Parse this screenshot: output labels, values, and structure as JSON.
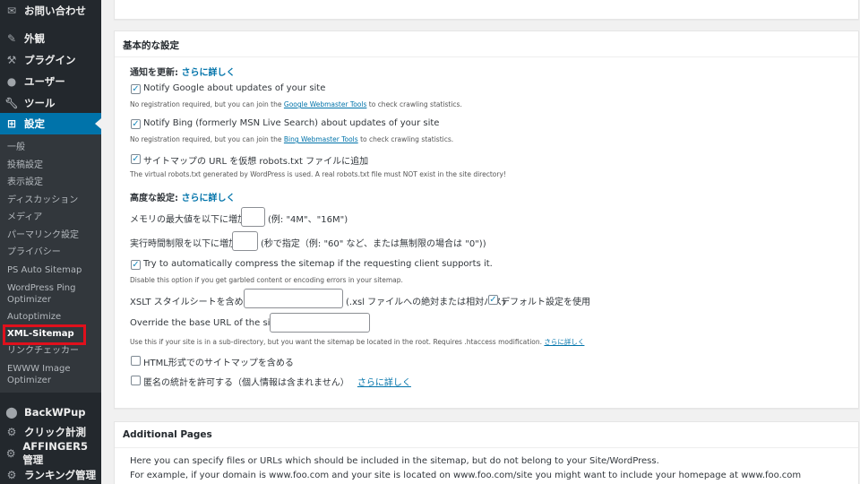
{
  "sidebar": {
    "top_items": [
      {
        "label": "お問い合わせ",
        "icon": "mail-icon"
      },
      {
        "label": "外観",
        "icon": "paintbrush-icon"
      },
      {
        "label": "プラグイン",
        "icon": "plugin-icon"
      },
      {
        "label": "ユーザー",
        "icon": "user-icon"
      },
      {
        "label": "ツール",
        "icon": "wrench-icon"
      },
      {
        "label": "設定",
        "icon": "settings-icon"
      }
    ],
    "submenu": [
      "一般",
      "投稿設定",
      "表示設定",
      "ディスカッション",
      "メディア",
      "パーマリンク設定",
      "プライバシー",
      "PS Auto Sitemap",
      "WordPress Ping Optimizer",
      "Autoptimize",
      "XML-Sitemap",
      "リンクチェッカー",
      "EWWW Image Optimizer"
    ],
    "bottom_items": [
      {
        "label": "BackWPup",
        "icon": "backwpup-icon"
      },
      {
        "label": "クリック計測",
        "icon": "gear-icon"
      },
      {
        "label": "AFFINGER5 管理",
        "icon": "gear-icon"
      },
      {
        "label": "ランキング管理",
        "icon": "gear-icon"
      }
    ]
  },
  "basic": {
    "title": "基本的な設定",
    "notify_heading": "通知を更新:",
    "more_link": "さらに詳しく",
    "google_label": "Notify Google about updates of your site",
    "google_note_pre": "No registration required, but you can join the ",
    "google_note_link": "Google Webmaster Tools",
    "google_note_post": " to check crawling statistics.",
    "bing_label": "Notify Bing (formerly MSN Live Search) about updates of your site",
    "bing_note_pre": "No registration required, but you can join the ",
    "bing_note_link": "Bing Webmaster Tools",
    "bing_note_post": " to check crawling statistics.",
    "robots_label": "サイトマップの URL を仮想 robots.txt ファイルに追加",
    "robots_note": "The virtual robots.txt generated by WordPress is used. A real robots.txt file must NOT exist in the site directory!",
    "advanced_heading": "高度な設定:",
    "memory_label": "メモリの最大値を以下に増加:",
    "memory_value": "",
    "memory_hint": "(例: \"4M\"、\"16M\")",
    "time_label": "実行時間制限を以下に増加:",
    "time_value": "",
    "time_hint": "(秒で指定（例: \"60\" など、または無制限の場合は \"0\"))",
    "compress_label": "Try to automatically compress the sitemap if the requesting client supports it.",
    "compress_note": "Disable this option if you get garbled content or encoding errors in your sitemap.",
    "xslt_label": "XSLT スタイルシートを含める:",
    "xslt_value": "",
    "xslt_hint": "(.xsl ファイルへの絶対または相対パス)",
    "default_label": "デフォルト設定を使用",
    "baseurl_label": "Override the base URL of the sitemap:",
    "baseurl_value": "",
    "baseurl_note": "Use this if your site is in a sub-directory, but you want the sitemap be located in the root. Requires .htaccess modification.",
    "html_label": "HTML形式でのサイトマップを含める",
    "stats_label": "匿名の統計を許可する（個人情報は含まれません）"
  },
  "additional": {
    "title": "Additional Pages",
    "line1": "Here you can specify files or URLs which should be included in the sitemap, but do not belong to your Site/WordPress.",
    "line2": "For example, if your domain is www.foo.com and your site is located on www.foo.com/site you might want to include your homepage at www.foo.com"
  },
  "colors": {
    "sidebar_bg": "#23282d",
    "submenu_bg": "#32373c",
    "accent": "#0073aa",
    "highlight_box": "#e0101c"
  }
}
